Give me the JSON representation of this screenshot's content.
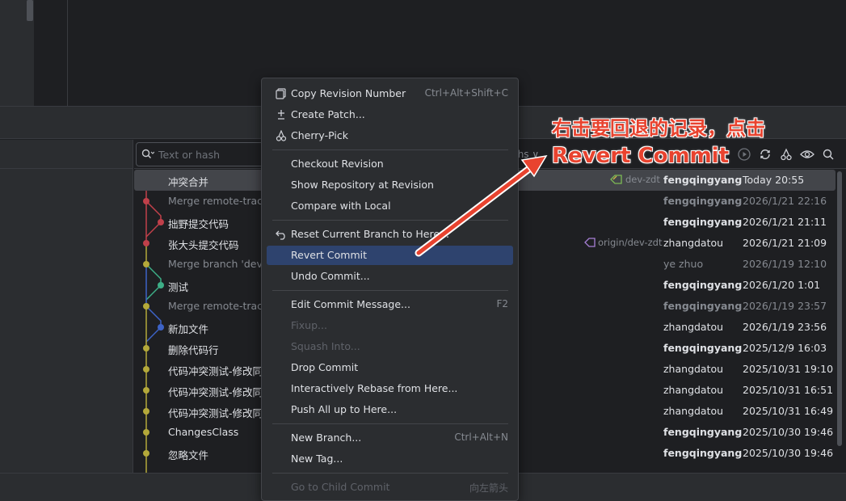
{
  "search": {
    "placeholder": "Text or hash"
  },
  "filters": {
    "paths_label": "ths ∨"
  },
  "rows": [
    {
      "subject": "冲突合并",
      "author": "fengqingyang",
      "date": "Today 20:55",
      "ref": "dev-zdt",
      "selected": true
    },
    {
      "subject": "Merge remote-tracking branch",
      "author": "fengqingyang",
      "date": "2026/1/21 22:16",
      "dim": true
    },
    {
      "subject": "拙野提交代码",
      "author": "fengqingyang",
      "date": "2026/1/21 21:11"
    },
    {
      "subject": "张大头提交代码",
      "author": "zhangdatou",
      "date": "2026/1/21 21:09",
      "ref": "origin/dev-zdt"
    },
    {
      "subject": "Merge branch 'dev-zdt'",
      "author": "ye zhuo",
      "date": "2026/1/19 12:10",
      "dim": true
    },
    {
      "subject": "测试",
      "author": "fengqingyang",
      "date": "2026/1/20 1:01"
    },
    {
      "subject": "Merge remote-tracking branch",
      "author": "fengqingyang",
      "date": "2026/1/19 23:57",
      "dim": true
    },
    {
      "subject": "新加文件",
      "author": "zhangdatou",
      "date": "2026/1/19 23:56"
    },
    {
      "subject": "删除代码行",
      "author": "fengqingyang",
      "date": "2025/12/9 16:03"
    },
    {
      "subject": "代码冲突测试-修改同一行",
      "author": "zhangdatou",
      "date": "2025/10/31 19:10"
    },
    {
      "subject": "代码冲突测试-修改同一行",
      "author": "zhangdatou",
      "date": "2025/10/31 16:51"
    },
    {
      "subject": "代码冲突测试-修改同一行",
      "author": "zhangdatou",
      "date": "2025/10/31 16:49"
    },
    {
      "subject": "ChangesClass",
      "author": "fengqingyang",
      "date": "2025/10/30 19:46"
    },
    {
      "subject": "忽略文件",
      "author": "fengqingyang",
      "date": "2025/10/30 19:46"
    }
  ],
  "menu": {
    "copy_revision": {
      "label": "Copy Revision Number",
      "shortcut": "Ctrl+Alt+Shift+C"
    },
    "create_patch": {
      "label": "Create Patch..."
    },
    "cherry_pick": {
      "label": "Cherry-Pick"
    },
    "checkout_revision": {
      "label": "Checkout Revision"
    },
    "show_repository": {
      "label": "Show Repository at Revision"
    },
    "compare_local": {
      "label": "Compare with Local"
    },
    "reset_branch": {
      "label": "Reset Current Branch to Here..."
    },
    "revert_commit": {
      "label": "Revert Commit"
    },
    "undo_commit": {
      "label": "Undo Commit..."
    },
    "edit_message": {
      "label": "Edit Commit Message...",
      "shortcut": "F2"
    },
    "fixup": {
      "label": "Fixup..."
    },
    "squash": {
      "label": "Squash Into..."
    },
    "drop_commit": {
      "label": "Drop Commit"
    },
    "interactive_rebase": {
      "label": "Interactively Rebase from Here..."
    },
    "push_all": {
      "label": "Push All up to Here..."
    },
    "new_branch": {
      "label": "New Branch...",
      "shortcut": "Ctrl+Alt+N"
    },
    "new_tag": {
      "label": "New Tag..."
    },
    "go_child": {
      "label": "Go to Child Commit",
      "shortcut": "向左箭头"
    }
  },
  "annotation": {
    "line1": "右击要回退的记录，点击",
    "line2": "Revert Commit"
  },
  "colors": {
    "accent": "#2e436e",
    "annotation": "#e8432f",
    "graph_red": "#c0404a",
    "graph_yellow": "#b4a93a",
    "graph_green": "#3dae86",
    "graph_blue": "#3d63c7"
  }
}
